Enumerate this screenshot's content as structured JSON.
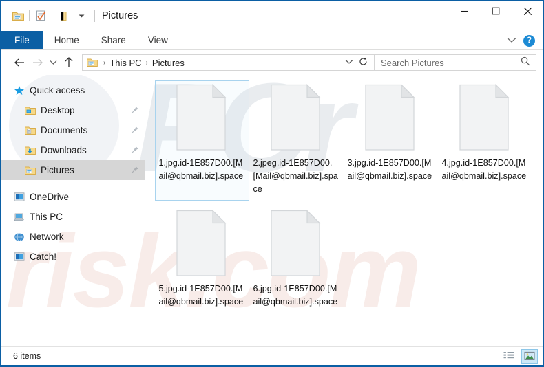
{
  "window": {
    "title": "Pictures",
    "quick_access_icons": [
      "folder-properties-icon",
      "checklist-icon",
      "new-folder-icon",
      "chevron-down-icon"
    ],
    "controls": {
      "minimize": "─",
      "maximize": "☐",
      "close": "✕"
    },
    "accent_color": "#0b5fa4"
  },
  "ribbon": {
    "tabs": [
      {
        "label": "File",
        "active": true
      },
      {
        "label": "Home",
        "active": false
      },
      {
        "label": "Share",
        "active": false
      },
      {
        "label": "View",
        "active": false
      }
    ],
    "collapse_icon": "chevron-down-icon",
    "help_label": "?"
  },
  "address_bar": {
    "back_icon": "arrow-left-icon",
    "forward_icon": "arrow-right-icon",
    "recent_icon": "chevron-down-icon",
    "up_icon": "arrow-up-icon",
    "breadcrumb_icon": "pictures-folder-icon",
    "breadcrumbs": [
      "This PC",
      "Pictures"
    ],
    "separator": "›",
    "dropdown_icon": "chevron-down-icon",
    "refresh_icon": "refresh-icon"
  },
  "search": {
    "placeholder": "Search Pictures",
    "value": "",
    "icon": "search-icon"
  },
  "sidebar": {
    "items": [
      {
        "label": "Quick access",
        "icon": "star-icon",
        "indent": false,
        "pinned": false,
        "selected": false
      },
      {
        "label": "Desktop",
        "icon": "desktop-folder-icon",
        "indent": true,
        "pinned": true,
        "selected": false
      },
      {
        "label": "Documents",
        "icon": "documents-folder-icon",
        "indent": true,
        "pinned": true,
        "selected": false
      },
      {
        "label": "Downloads",
        "icon": "downloads-folder-icon",
        "indent": true,
        "pinned": true,
        "selected": false
      },
      {
        "label": "Pictures",
        "icon": "pictures-folder-icon",
        "indent": true,
        "pinned": true,
        "selected": true
      },
      {
        "label": "OneDrive",
        "icon": "onedrive-icon",
        "indent": false,
        "pinned": false,
        "selected": false
      },
      {
        "label": "This PC",
        "icon": "this-pc-icon",
        "indent": false,
        "pinned": false,
        "selected": false
      },
      {
        "label": "Network",
        "icon": "network-icon",
        "indent": false,
        "pinned": false,
        "selected": false
      },
      {
        "label": "Catch!",
        "icon": "drive-icon",
        "indent": false,
        "pinned": false,
        "selected": false
      }
    ]
  },
  "files": [
    {
      "name": "1.jpg.id-1E857D00.[Mail@qbmail.biz].space",
      "icon": "blank-document-icon",
      "selected": true
    },
    {
      "name": "2.jpeg.id-1E857D00.[Mail@qbmail.biz].space",
      "icon": "blank-document-icon",
      "selected": false
    },
    {
      "name": "3.jpg.id-1E857D00.[Mail@qbmail.biz].space",
      "icon": "blank-document-icon",
      "selected": false
    },
    {
      "name": "4.jpg.id-1E857D00.[Mail@qbmail.biz].space",
      "icon": "blank-document-icon",
      "selected": false
    },
    {
      "name": "5.jpg.id-1E857D00.[Mail@qbmail.biz].space",
      "icon": "blank-document-icon",
      "selected": false
    },
    {
      "name": "6.jpg.id-1E857D00.[Mail@qbmail.biz].space",
      "icon": "blank-document-icon",
      "selected": false
    }
  ],
  "status_bar": {
    "item_count_text": "6 items",
    "views": [
      {
        "name": "details-view-button",
        "active": false
      },
      {
        "name": "large-icons-view-button",
        "active": true
      }
    ]
  },
  "watermarks": {
    "logo_text": "PCr",
    "site_text": "risk.com"
  }
}
